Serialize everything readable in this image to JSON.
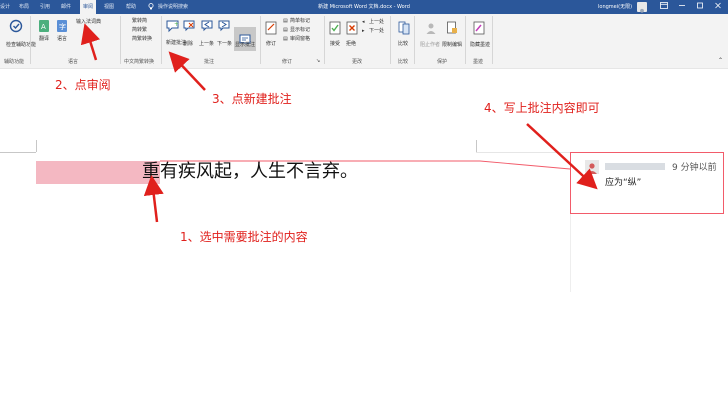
{
  "titlebar": {
    "tabs": [
      "设计",
      "布局",
      "引用",
      "邮件",
      "审阅",
      "视图",
      "帮助"
    ],
    "search": "操作说明搜索",
    "doc_title": "新建 Microsoft Word 文档.docx - Word",
    "user_name": "longmei(无限)"
  },
  "ribbon": {
    "proofing": {
      "label": "检查辅助功能",
      "group": "辅助功能"
    },
    "language": {
      "translate": "翻译",
      "language": "语言",
      "input_dict": "输入法词典",
      "group": "语言"
    },
    "chinese": {
      "trad_to_simp": "繁转简",
      "simp_to_trad": "简转繁",
      "convert": "简繁转换",
      "group": "中文简繁转换"
    },
    "comments": {
      "new": "新建批注",
      "delete": "删除",
      "prev": "上一条",
      "next": "下一条",
      "show": "显示批注",
      "group": "批注"
    },
    "tracking": {
      "track": "修订",
      "markup": "简单标记",
      "show_markup": "显示标记",
      "pane": "审阅窗格",
      "group": "修订"
    },
    "changes": {
      "accept": "接受",
      "reject": "拒绝",
      "prev": "上一处",
      "next": "下一处",
      "group": "更改"
    },
    "compare": {
      "label": "比较",
      "group": "比较"
    },
    "protect": {
      "block": "阻止作者",
      "restrict": "限制编辑",
      "group": "保护"
    },
    "ink": {
      "hide": "隐藏墨迹",
      "group": "墨迹"
    }
  },
  "document": {
    "text": "重有疾风起，人生不言弃。",
    "comment_time": "9 分钟以前",
    "comment_text": "应为“纵”"
  },
  "annotations": {
    "step1": "1、选中需要批注的内容",
    "step2": "2、点审阅",
    "step3": "3、点新建批注",
    "step4": "4、写上批注内容即可"
  },
  "colors": {
    "accent": "#2b579a",
    "annotation": "#e0201c",
    "highlight": "#f4b8c2"
  }
}
